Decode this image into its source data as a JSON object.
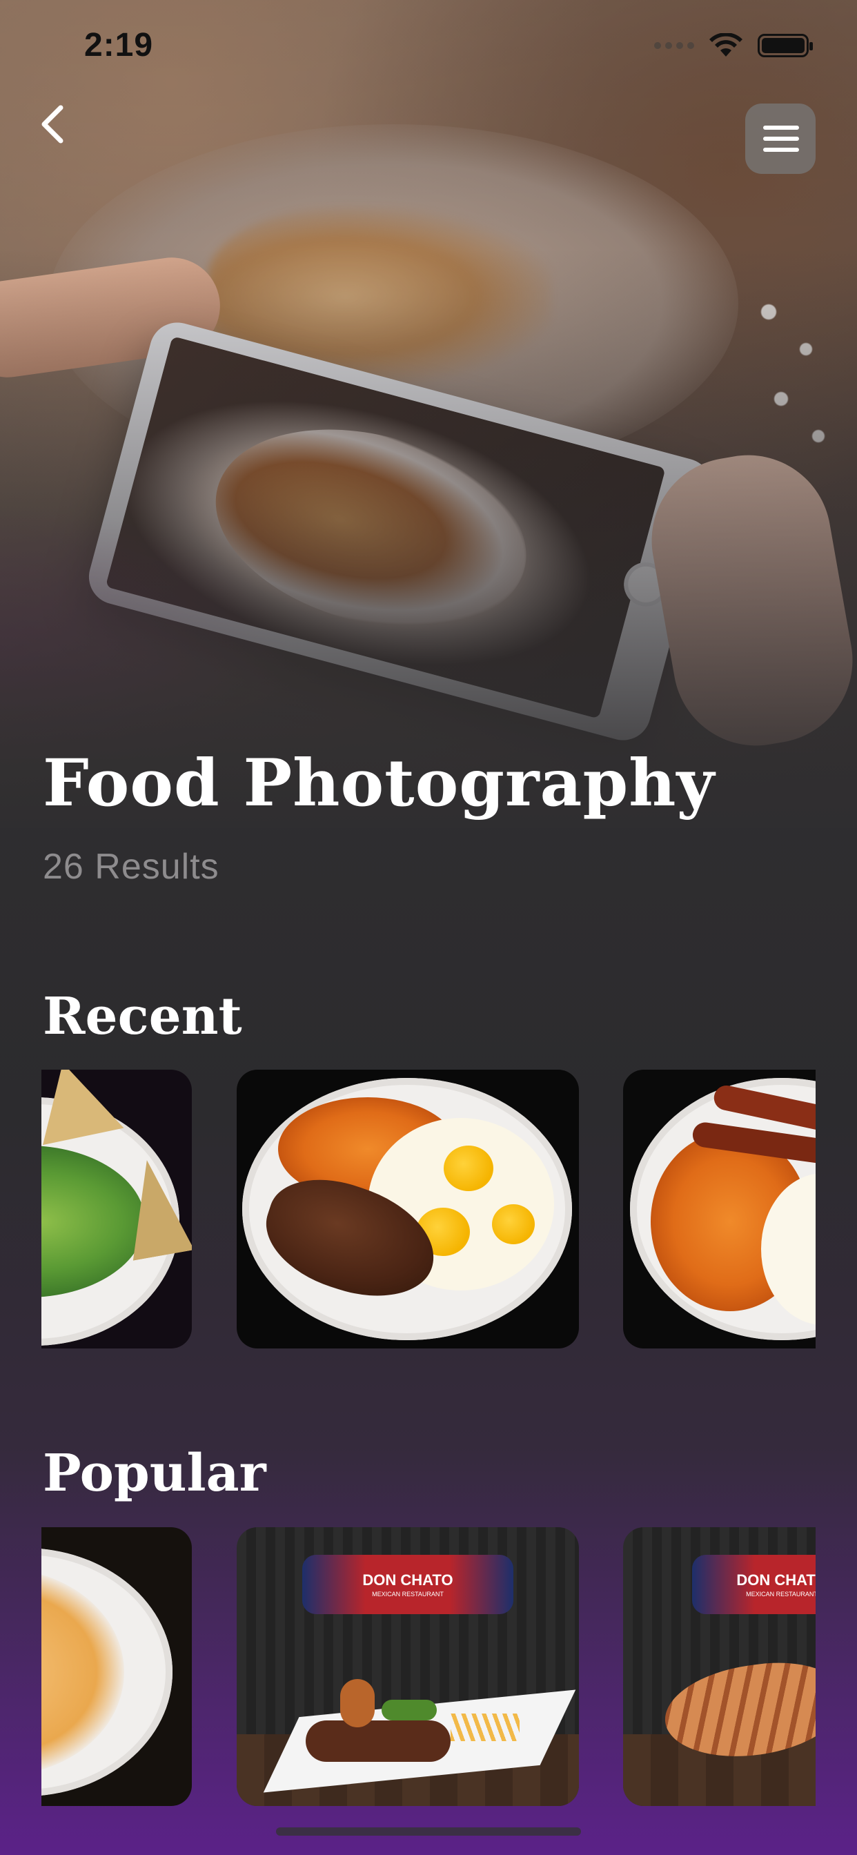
{
  "status_bar": {
    "time": "2:19"
  },
  "header": {
    "title": "Food Photography",
    "results": "26 Results"
  },
  "sections": [
    {
      "title": "Recent"
    },
    {
      "title": "Popular"
    }
  ],
  "popular_cards": [
    {
      "logo_text": "DON CHATO",
      "logo_subtext": "MEXICAN RESTAURANT"
    },
    {
      "logo_text": "DON CHATO",
      "logo_subtext": "MEXICAN RESTAURANT"
    }
  ],
  "icons": [
    "back-chevron-icon",
    "menu-icon",
    "signal-icon",
    "wifi-icon",
    "battery-icon"
  ]
}
